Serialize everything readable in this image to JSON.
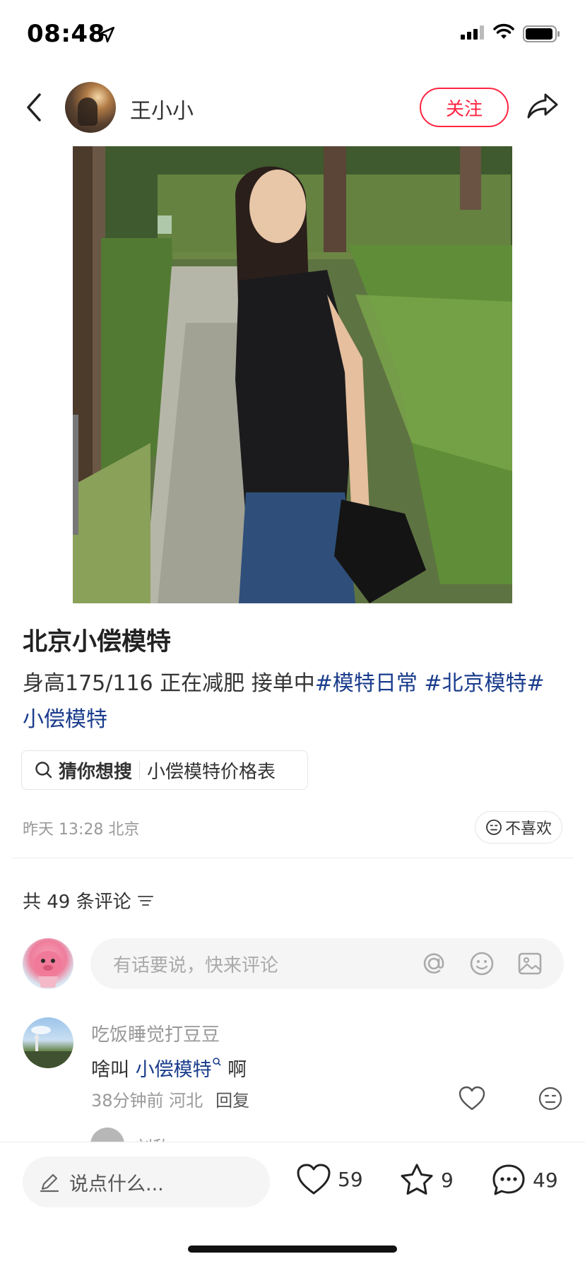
{
  "status_bar": {
    "time": "08:48"
  },
  "header": {
    "author_name": "王小小",
    "follow_label": "关注"
  },
  "post": {
    "title": "北京小偿模特",
    "body_text": "身高175/116 正在减肥 接单中",
    "hashtags": [
      "#模特日常 ",
      "#北京模特#",
      "小偿模特"
    ],
    "search_chip": {
      "prefix": "猜你想搜",
      "query": "小偿模特价格表"
    },
    "meta": "昨天 13:28 北京",
    "dislike_label": "不喜欢"
  },
  "comments_section": {
    "count_label": "共 49 条评论",
    "input_placeholder": "有话要说，快来评论",
    "items": [
      {
        "user": "吃饭睡觉打豆豆",
        "text_before": "啥叫 ",
        "link_text": "小偿模特",
        "text_after": " 啊",
        "time_location": "38分钟前  河北",
        "reply_label": "回复"
      }
    ],
    "sub_preview_user": "刘敌"
  },
  "bottom_bar": {
    "input_placeholder": "说点什么...",
    "likes": "59",
    "favorites": "9",
    "comments": "49"
  },
  "colors": {
    "accent": "#ff2442",
    "hashtag": "#1a3c8c"
  }
}
